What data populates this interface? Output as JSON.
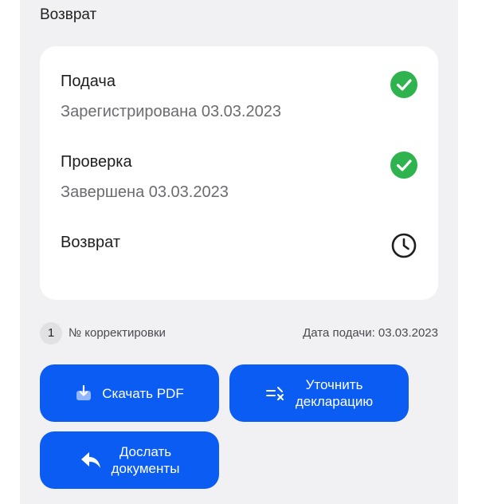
{
  "section": {
    "title": "Возврат"
  },
  "steps": [
    {
      "title": "Подача",
      "subtitle": "Зарегистрирована 03.03.2023",
      "status_icon": "check-circle-icon",
      "color": "#2fb34f"
    },
    {
      "title": "Проверка",
      "subtitle": "Завершена 03.03.2023",
      "status_icon": "check-circle-icon",
      "color": "#2fb34f"
    },
    {
      "title": "Возврат",
      "subtitle": "",
      "status_icon": "clock-icon",
      "color": "#1e1e1e"
    }
  ],
  "meta": {
    "correction_number": "1",
    "correction_label": "№ корректировки",
    "submit_date": "Дата подачи: 03.03.2023"
  },
  "actions": {
    "download_pdf": "Скачать PDF",
    "clarify_line1": "Уточнить",
    "clarify_line2": "декларацию",
    "send_docs_line1": "Дослать",
    "send_docs_line2": "документы"
  },
  "colors": {
    "accent": "#0b5cf2",
    "success": "#2fb34f",
    "panel_bg": "#f1f1f3"
  }
}
